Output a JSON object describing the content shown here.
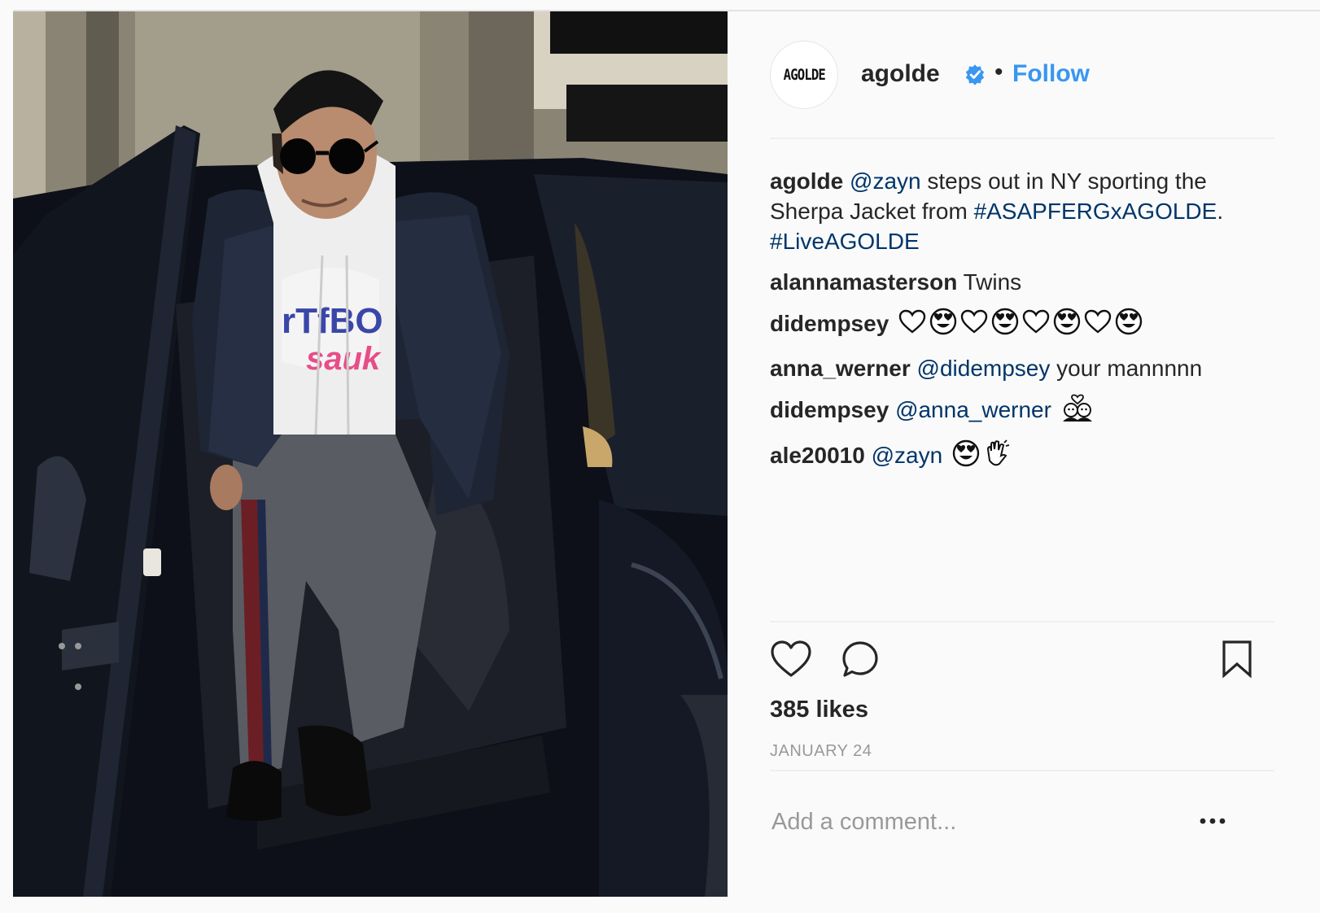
{
  "post": {
    "avatar_text": "AGOLDE",
    "username": "agolde",
    "separator": "•",
    "follow_label": "Follow",
    "accent_color": "#3897f0",
    "link_color": "#003569"
  },
  "comments": [
    {
      "user": "agolde",
      "parts": [
        {
          "type": "tag",
          "text": "@zayn"
        },
        {
          "type": "text",
          "text": " steps out in NY sporting the Sherpa Jacket from "
        },
        {
          "type": "tag",
          "text": "#ASAPFERGxAGOLDE"
        },
        {
          "type": "text",
          "text": ". "
        },
        {
          "type": "tag",
          "text": "#LiveAGOLDE"
        }
      ]
    },
    {
      "user": "alannamasterson",
      "parts": [
        {
          "type": "text",
          "text": " Twins"
        }
      ]
    },
    {
      "user": "didempsey",
      "parts": [
        {
          "type": "text",
          "text": " "
        }
      ],
      "emojis": [
        "white-heart",
        "heart-eyes",
        "white-heart",
        "heart-eyes",
        "white-heart",
        "heart-eyes",
        "white-heart",
        "heart-eyes"
      ]
    },
    {
      "user": "anna_werner",
      "parts": [
        {
          "type": "tag",
          "text": "@didempsey"
        },
        {
          "type": "text",
          "text": " your mannnnn"
        }
      ]
    },
    {
      "user": "didempsey",
      "parts": [
        {
          "type": "tag",
          "text": "@anna_werner"
        },
        {
          "type": "text",
          "text": " "
        }
      ],
      "emojis": [
        "couple-with-heart"
      ]
    },
    {
      "user": "ale20010",
      "parts": [
        {
          "type": "tag",
          "text": "@zayn"
        },
        {
          "type": "text",
          "text": " "
        }
      ],
      "emojis": [
        "heart-eyes",
        "clapping-hands"
      ]
    }
  ],
  "actions": {
    "like_icon": "heart-icon",
    "comment_icon": "comment-icon",
    "save_icon": "bookmark-icon",
    "more_icon": "more-options-icon"
  },
  "likes_text": "385 likes",
  "date_text": "JANUARY 24",
  "add_comment_placeholder": "Add a comment..."
}
